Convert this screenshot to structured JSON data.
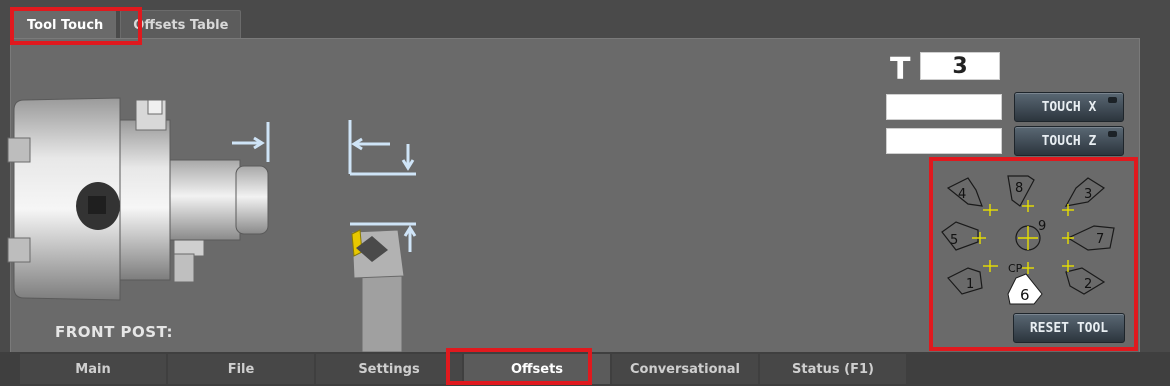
{
  "top_tabs": [
    {
      "label": "Tool Touch",
      "active": true
    },
    {
      "label": "Offsets Table",
      "active": false
    }
  ],
  "front_post_label": "FRONT POST:",
  "tool": {
    "label": "T",
    "value": "3"
  },
  "touch_x": {
    "value": "",
    "button_label": "TOUCH X"
  },
  "touch_z": {
    "value": "",
    "button_label": "TOUCH Z"
  },
  "orientations": {
    "labels": [
      "1",
      "2",
      "3",
      "4",
      "5",
      "6",
      "7",
      "8",
      "9",
      "CP"
    ],
    "selected": "6",
    "reset_label": "RESET TOOL"
  },
  "bottom_tabs": [
    {
      "label": "Main",
      "active": false
    },
    {
      "label": "File",
      "active": false
    },
    {
      "label": "Settings",
      "active": false
    },
    {
      "label": "Offsets",
      "active": true
    },
    {
      "label": "Conversational",
      "active": false
    },
    {
      "label": "Status (F1)",
      "active": false
    }
  ],
  "colors": {
    "highlight": "#e0191e",
    "crosshair": "#e8e000",
    "button": "#3a4650"
  }
}
